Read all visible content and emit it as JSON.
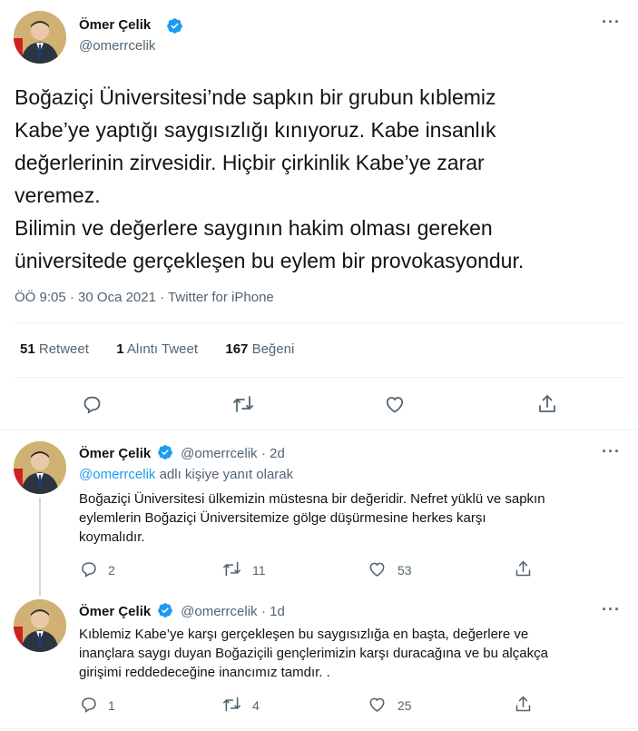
{
  "main_tweet": {
    "author_name": "Ömer Çelik",
    "author_handle": "@omerrcelik",
    "text_lines": [
      "Boğaziçi Üniversitesi’nde sapkın bir grubun kıblemiz",
      "Kabe’ye yaptığı saygısızlığı kınıyoruz. Kabe insanlık",
      "değerlerinin zirvesidir. Hiçbir çirkinlik Kabe’ye zarar",
      "veremez.",
      "Bilimin ve değerlere saygının hakim olması gereken",
      "üniversitede gerçekleşen bu eylem bir provokasyondur."
    ],
    "time": "ÖÖ 9:05",
    "date": "30 Oca 2021",
    "source": "Twitter for iPhone",
    "retweets": "51",
    "retweets_label": "Retweet",
    "quotes": "1",
    "quotes_label": "Alıntı Tweet",
    "likes": "167",
    "likes_label": "Beğeni"
  },
  "replies": [
    {
      "author_name": "Ömer Çelik",
      "author_handle": "@omerrcelik",
      "age": "· 2d",
      "replying_to_handle": "@omerrcelik",
      "replying_to_suffix": "adlı kişiye yanıt olarak",
      "text_lines": [
        "Boğaziçi Üniversitesi ülkemizin müstesna bir değeridir. Nefret yüklü ve sapkın",
        "eylemlerin Boğaziçi Üniversitemize gölge düşürmesine herkes karşı",
        "koymalıdır."
      ],
      "reply_count": "2",
      "retweet_count": "11",
      "like_count": "53"
    },
    {
      "author_name": "Ömer Çelik",
      "author_handle": "@omerrcelik",
      "age": "· 1d",
      "text_lines": [
        "Kıblemiz Kabe’ye karşı gerçekleşen bu saygısızlığa en başta, değerlere ve",
        "inançlara saygı duyan Boğaziçili gençlerimizin  karşı duracağına ve bu alçakça",
        "girişimi reddedeceğine inancımız tamdır. ."
      ],
      "reply_count": "1",
      "retweet_count": "4",
      "like_count": "25"
    }
  ],
  "colors": {
    "accent": "#1d9bf0",
    "secondary_text": "#536471",
    "divider": "#eff3f4"
  },
  "icons": [
    "verified-badge-icon",
    "more-icon",
    "reply-icon",
    "retweet-icon",
    "like-icon",
    "share-icon"
  ]
}
